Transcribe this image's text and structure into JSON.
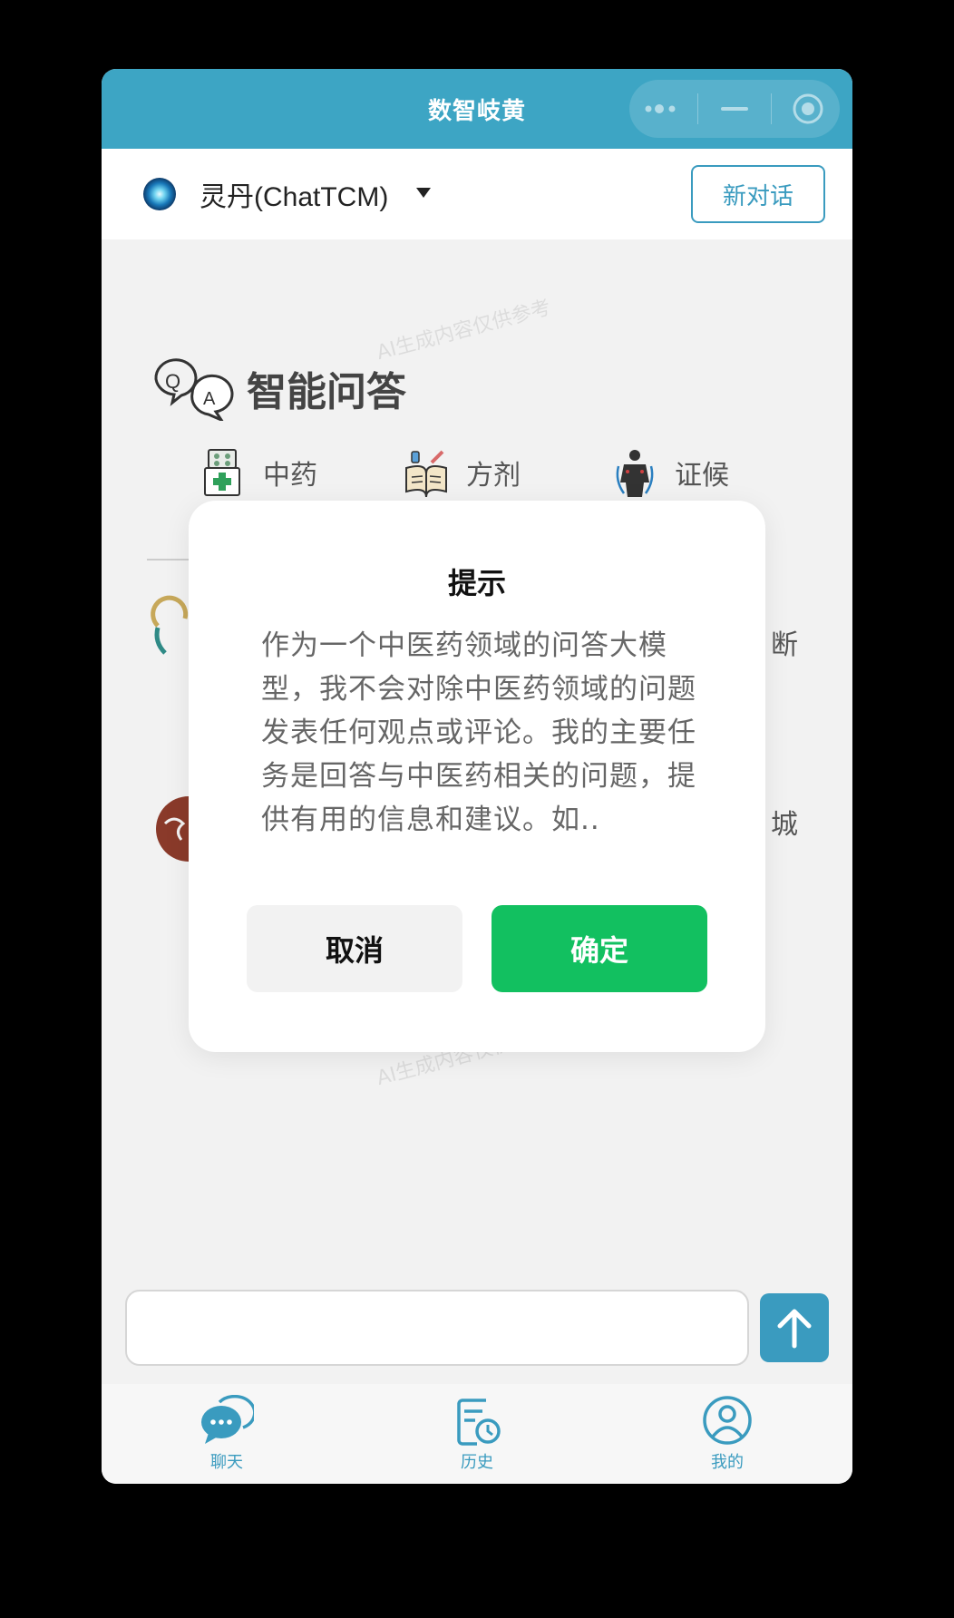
{
  "window": {
    "title": "数智岐黄"
  },
  "titlebar": {
    "icons": [
      "more-dots-icon",
      "minimize-icon",
      "record-icon"
    ]
  },
  "toolbar": {
    "model_name": "灵丹(ChatTCM)",
    "new_chat_label": "新对话"
  },
  "watermark": "AI生成内容仅供参考",
  "section": {
    "title": "智能问答",
    "categories": [
      {
        "label": "中药",
        "icon": "medicine-box-icon"
      },
      {
        "label": "方剂",
        "icon": "prescription-book-icon"
      },
      {
        "label": "证候",
        "icon": "body-meridian-icon"
      }
    ]
  },
  "background_partial_text": [
    "断",
    "城"
  ],
  "dialog": {
    "title": "提示",
    "body": "作为一个中医药领域的问答大模型，我不会对除中医药领域的问题发表任何观点或评论。我的主要任务是回答与中医药相关的问题，提供有用的信息和建议。如..",
    "cancel_label": "取消",
    "confirm_label": "确定"
  },
  "input": {
    "value": "",
    "placeholder": ""
  },
  "tabs": [
    {
      "label": "聊天",
      "icon": "chat-bubble-icon"
    },
    {
      "label": "历史",
      "icon": "history-clock-icon"
    },
    {
      "label": "我的",
      "icon": "profile-icon"
    }
  ],
  "colors": {
    "accent": "#3a9bbf",
    "titlebar": "#3da5c4",
    "confirm": "#12c060"
  }
}
